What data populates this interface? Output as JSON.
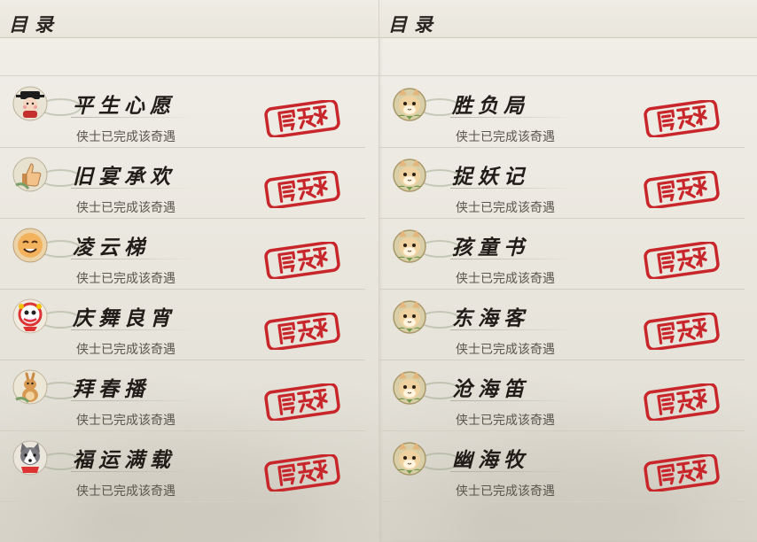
{
  "pages": [
    {
      "header_title": "目录",
      "entries": [
        {
          "name": "平生心愿",
          "status": "侠士已完成该奇遇",
          "icon": "official-character-icon"
        },
        {
          "name": "旧宴承欢",
          "status": "侠士已完成该奇遇",
          "icon": "thumbs-up-icon"
        },
        {
          "name": "凌云梯",
          "status": "侠士已完成该奇遇",
          "icon": "smiley-face-icon"
        },
        {
          "name": "庆舞良宵",
          "status": "侠士已完成该奇遇",
          "icon": "lion-dance-icon"
        },
        {
          "name": "拜春播",
          "status": "侠士已完成该奇遇",
          "icon": "kangaroo-icon"
        },
        {
          "name": "福运满载",
          "status": "侠士已完成该奇遇",
          "icon": "husky-dog-icon"
        }
      ]
    },
    {
      "header_title": "目录",
      "entries": [
        {
          "name": "胜负局",
          "status": "侠士已完成该奇遇",
          "icon": "cat-face-icon"
        },
        {
          "name": "捉妖记",
          "status": "侠士已完成该奇遇",
          "icon": "cat-face-icon"
        },
        {
          "name": "孩童书",
          "status": "侠士已完成该奇遇",
          "icon": "cat-face-icon"
        },
        {
          "name": "东海客",
          "status": "侠士已完成该奇遇",
          "icon": "cat-face-icon"
        },
        {
          "name": "沧海笛",
          "status": "侠士已完成该奇遇",
          "icon": "cat-face-icon"
        },
        {
          "name": "幽海牧",
          "status": "侠士已完成该奇遇",
          "icon": "cat-face-icon"
        }
      ]
    }
  ],
  "colors": {
    "stamp_red": "#c8262a",
    "title_text": "#211c17",
    "status_text": "#5a554c"
  }
}
